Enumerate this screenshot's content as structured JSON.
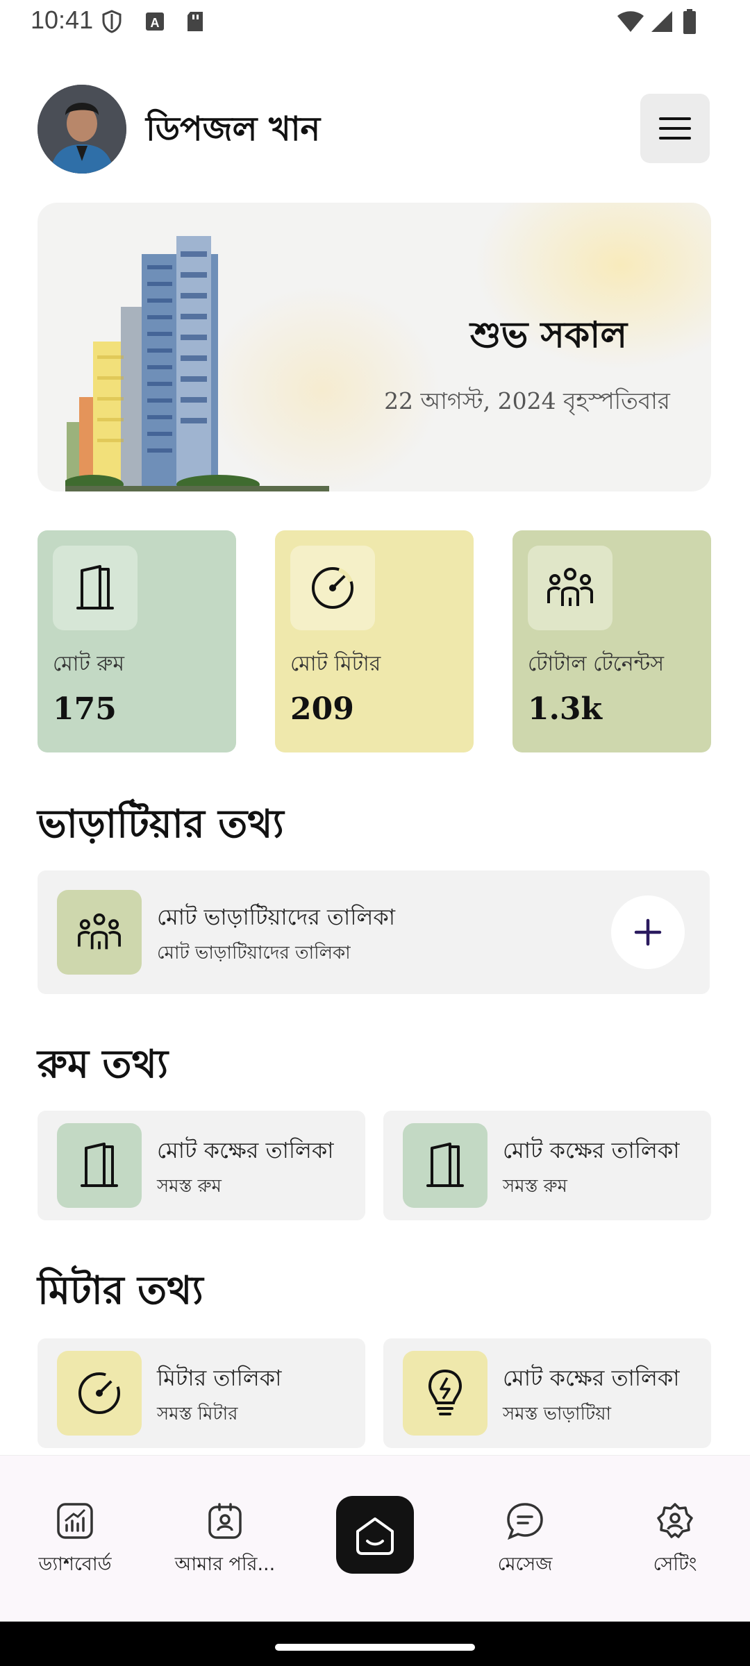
{
  "status_bar": {
    "time": "10:41"
  },
  "header": {
    "username": "ডিপজল খান"
  },
  "hero": {
    "greeting": "শুভ সকাল",
    "date": "22 আগস্ট, 2024 বৃহস্পতিবার"
  },
  "stats": [
    {
      "label": "মোট রুম",
      "value": "175",
      "icon": "door-icon",
      "color": "#c3d9c4",
      "icon_bg": "#d6e6d6"
    },
    {
      "label": "মোট মিটার",
      "value": "209",
      "icon": "meter-icon",
      "color": "#efe8ac",
      "icon_bg": "#f5f0c8"
    },
    {
      "label": "টোটাল টেনেন্টস",
      "value": "1.3k",
      "icon": "people-icon",
      "color": "#ced7ad",
      "icon_bg": "#e0e6c8"
    }
  ],
  "tenant_section": {
    "title": "ভাড়াটিয়ার তথ্য",
    "card": {
      "title": "মোট ভাড়াটিয়াদের তালিকা",
      "subtitle": "মোট ভাড়াটিয়াদের তালিকা",
      "icon": "people-icon",
      "add_label": "+"
    }
  },
  "room_section": {
    "title": "রুম তথ্য",
    "cards": [
      {
        "title": "মোট কক্ষের তালিকা",
        "subtitle": "সমস্ত রুম",
        "icon": "door-icon"
      },
      {
        "title": "মোট কক্ষের তালিকা",
        "subtitle": "সমস্ত রুম",
        "icon": "door-icon"
      }
    ]
  },
  "meter_section": {
    "title": "মিটার তথ্য",
    "cards": [
      {
        "title": "মিটার তালিকা",
        "subtitle": "সমস্ত মিটার",
        "icon": "meter-icon"
      },
      {
        "title": "মোট কক্ষের তালিকা",
        "subtitle": "সমস্ত ভাড়াটিয়া",
        "icon": "bulb-icon"
      }
    ]
  },
  "bottom_nav": [
    {
      "label": "ড্যাশবোর্ড",
      "icon": "chart-icon"
    },
    {
      "label": "আমার পরি...",
      "icon": "profile-icon"
    },
    {
      "label": "",
      "icon": "home-icon"
    },
    {
      "label": "মেসেজ",
      "icon": "chat-icon"
    },
    {
      "label": "সেটিং",
      "icon": "settings-icon"
    }
  ]
}
